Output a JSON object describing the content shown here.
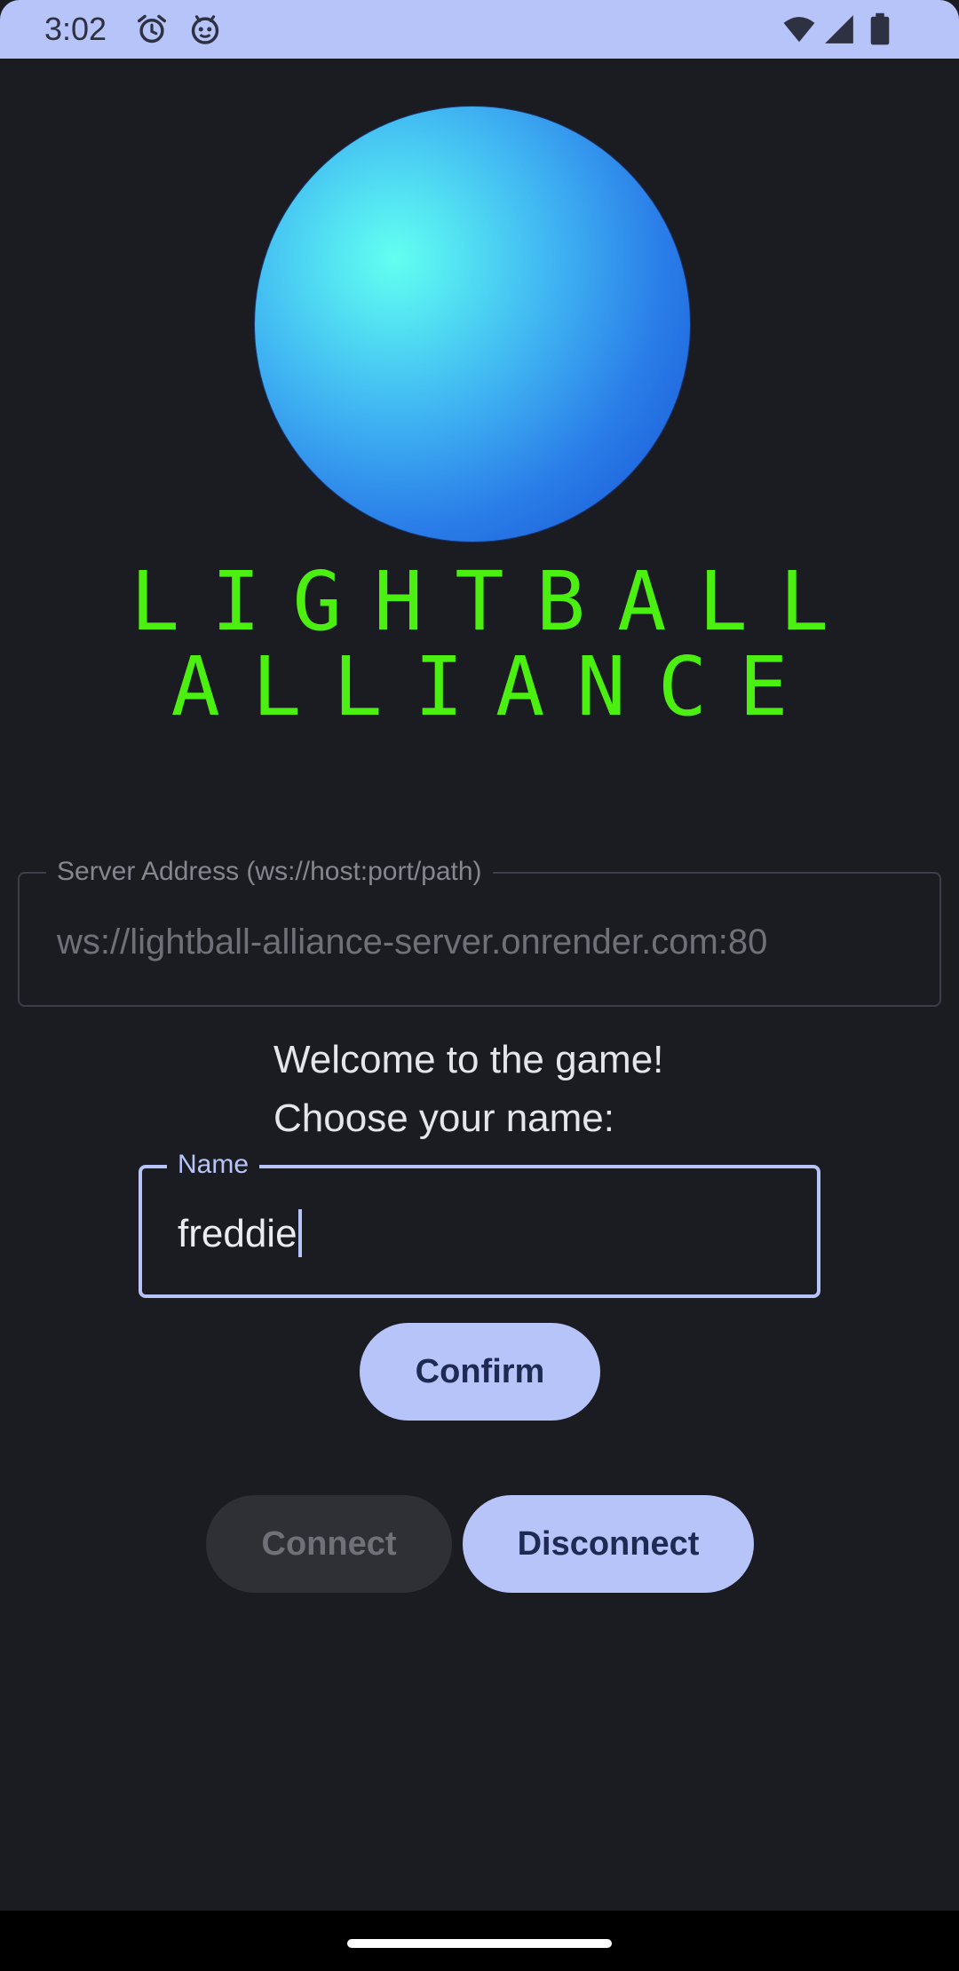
{
  "status_bar": {
    "time": "3:02",
    "icons_left": [
      "alarm-icon",
      "debug-bot-icon"
    ],
    "icons_right": [
      "wifi-icon",
      "cellular-signal-icon",
      "battery-icon"
    ]
  },
  "logo": {
    "ball": "glowing-blue-sphere",
    "title_line1": "LIGHTBALL",
    "title_line2": "ALLIANCE"
  },
  "server_address": {
    "label": "Server Address (ws://host:port/path)",
    "value": "ws://lightball-alliance-server.onrender.com:80"
  },
  "welcome": {
    "line1": "Welcome to the game!",
    "line2": "Choose your name:"
  },
  "name_field": {
    "label": "Name",
    "value": "freddie"
  },
  "buttons": {
    "confirm": "Confirm",
    "connect": "Connect",
    "disconnect": "Disconnect"
  },
  "colors": {
    "background": "#1b1c22",
    "accent": "#b6c4fa",
    "logo_text": "#4cf010",
    "ball_light": "#63fff0",
    "ball_dark": "#1f63d9"
  }
}
